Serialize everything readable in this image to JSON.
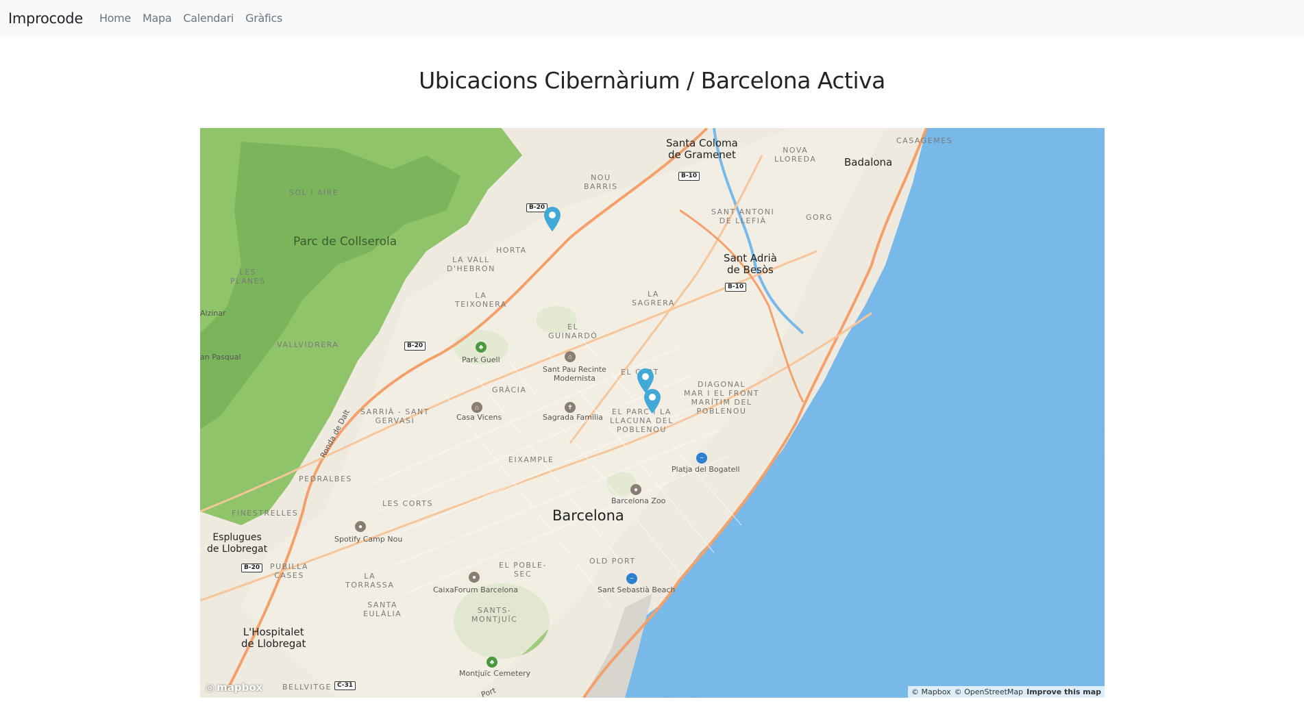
{
  "navbar": {
    "brand": "Improcode",
    "links": [
      "Home",
      "Mapa",
      "Calendari",
      "Gràfics"
    ]
  },
  "page": {
    "title": "Ubicacions Cibernàrium / Barcelona Activa"
  },
  "map": {
    "labels": {
      "santa_coloma": "Santa Coloma\nde Gramenet",
      "badalona": "Badalona",
      "casagemes": "CASAGEMES",
      "nova_lloreda": "NOVA\nLLOREDA",
      "sol_i_aire": "SOL I AIRE",
      "nou_barris": "NOU\nBARRIS",
      "sant_antoni_llefia": "SANT ANTONI\nDE LLEFIÀ",
      "gorg": "GORG",
      "parc_collserola": "Parc de Collserola",
      "horta": "HORTA",
      "les_planes": "LES\nPLANES",
      "vall_hebron": "LA VALL\nD'HEBRON",
      "sant_adria": "Sant Adrià\nde Besòs",
      "la_teixonera": "LA\nTEIXONERA",
      "la_sagrera": "LA\nSAGRERA",
      "alzinar": "Alzinar",
      "vallvidrera": "VALLVIDRERA",
      "el_guinardo": "EL\nGUINARDÓ",
      "park_guell": "Park Guell",
      "can_pasqual": "an Pasqual",
      "sant_pau": "Sant Pau Recinte\nModernista",
      "el_clot": "EL CLOT",
      "gracia": "GRÀCIA",
      "diagonal_mar": "DIAGONAL\nMAR I EL FRONT\nMARÍTIM DEL\nPOBLENOU",
      "sarria": "SARRIÀ - SANT\nGERVASI",
      "casa_vicens": "Casa Vicens",
      "sagrada_familia": "Sagrada Familia",
      "parc_llacuna": "EL PARC I LA\nLLACUNA DEL\nPOBLENOU",
      "ronda_dalt": "Ronda de Dalt",
      "eixample": "EIXAMPLE",
      "platja_bogatell": "Platja del Bogatell",
      "pedralbes": "PEDRALBES",
      "barcelona_zoo": "Barcelona Zoo",
      "les_corts": "LES CORTS",
      "finestrelles": "FINESTRELLES",
      "barcelona": "Barcelona",
      "esplugues": "Esplugues\nde Llobregat",
      "spotify_camp_nou": "Spotify Camp Nou",
      "pubilla_cases": "PUBILLA\nCASES",
      "el_poble_sec": "EL POBLE-\nSEC",
      "old_port": "OLD PORT",
      "la_torrassa": "LA\nTORRASSA",
      "caixaforum": "CaixaForum Barcelona",
      "sant_sebastia": "Sant Sebastià Beach",
      "santa_eulalia": "SANTA\nEULÀLIA",
      "sants_montjuic": "SANTS-\nMONTJUÏC",
      "hospitalet": "L'Hospitalet\nde Llobregat",
      "montjuic_cemetery": "Montjuïc Cemetery",
      "bellvitge": "BELLVITGE",
      "port": "Port"
    },
    "shields": {
      "b10_top": "B-10",
      "b20_top": "B-20",
      "b10_besos": "B-10",
      "b20_mid": "B-20",
      "b20_esplugues": "B-20",
      "c31": "C-31"
    },
    "markers": [
      "marker-nou-barris",
      "marker-el-clot",
      "marker-poblenou"
    ],
    "logo": "mapbox",
    "attribution": {
      "mapbox": "© Mapbox",
      "osm": "© OpenStreetMap",
      "improve": "Improve this map"
    }
  },
  "colors": {
    "sea": "#78b9ea",
    "land": "#efeadf",
    "forest": "#8fc46b",
    "forest_dark": "#6aa84f",
    "highway": "#f3a06b",
    "marker": "#41a9d6",
    "navbar_bg": "#f8f9fa"
  }
}
